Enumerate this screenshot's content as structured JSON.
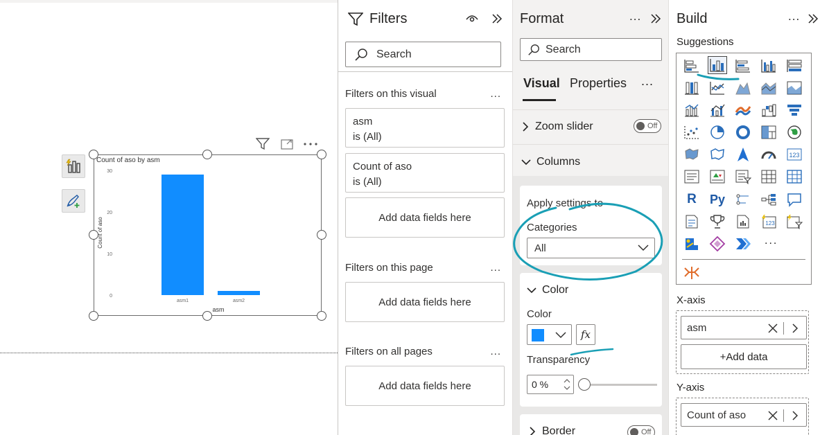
{
  "chart_data": {
    "type": "bar",
    "title": "Count of aso by asm",
    "xlabel": "asm",
    "ylabel": "Count of aso",
    "categories": [
      "asm1",
      "asm2"
    ],
    "values": [
      29,
      1
    ],
    "ylim": [
      0,
      30
    ],
    "yticks": [
      0,
      10,
      20,
      30
    ],
    "bar_color": "#118DFF",
    "grid": false,
    "legend": "none"
  },
  "filters": {
    "title": "Filters",
    "search_placeholder": "Search",
    "visual_section": "Filters on this visual",
    "page_section": "Filters on this page",
    "all_section": "Filters on all pages",
    "more": "...",
    "cards": [
      {
        "field": "asm",
        "state": "is (All)"
      },
      {
        "field": "Count of aso",
        "state": "is (All)"
      }
    ],
    "add_label": "Add data fields here"
  },
  "format": {
    "title": "Format",
    "more": "...",
    "search_placeholder": "Search",
    "tabs": [
      "Visual",
      "Properties"
    ],
    "tab_more": "...",
    "zoom_slider": "Zoom slider",
    "zoom_state": "Off",
    "columns": "Columns",
    "apply_settings": "Apply settings to",
    "categories_label": "Categories",
    "categories_value": "All",
    "color_section": "Color",
    "color_label": "Color",
    "color_value": "#118DFF",
    "fx": "fx",
    "transparency_label": "Transparency",
    "transparency_value": "0 %",
    "border": "Border",
    "border_state": "Off"
  },
  "build": {
    "title": "Build",
    "more": "...",
    "suggestions": "Suggestions",
    "grid_more": "...",
    "x_axis": "X-axis",
    "x_field": "asm",
    "add_data": "+Add data",
    "y_axis": "Y-axis",
    "y_field": "Count of aso"
  },
  "accent": "#1a9fb5"
}
